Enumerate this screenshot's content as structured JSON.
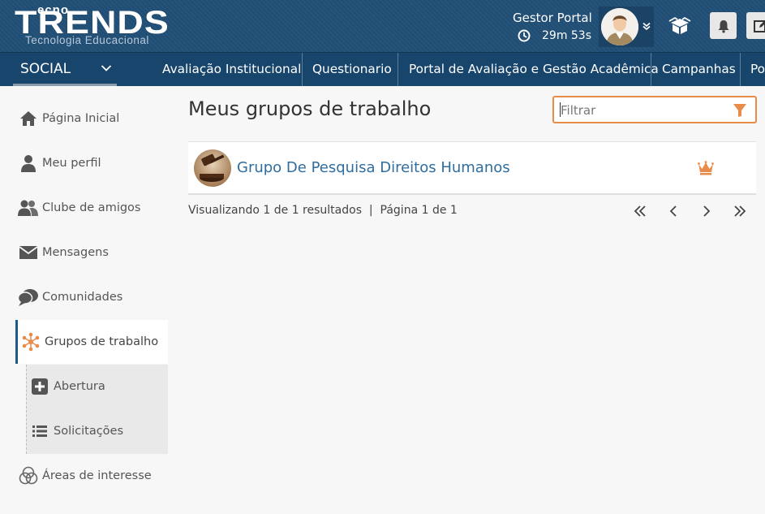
{
  "header": {
    "logo": {
      "top_text": "ecno",
      "main_text": "TRENDS",
      "sub_text": "Tecnologia Educacional"
    },
    "user_name": "Gestor Portal",
    "session_timer": "29m 53s",
    "icons": [
      "clock-icon",
      "avatar",
      "chevron-down-icon",
      "box-icon",
      "bell-icon",
      "edit-icon"
    ]
  },
  "nav": {
    "module": "SOCIAL",
    "items": [
      {
        "label": "Avaliação Institucional"
      },
      {
        "label": "Questionario"
      },
      {
        "label": "Portal de Avaliação e Gestão Acadêmica"
      },
      {
        "label": "Campanhas"
      },
      {
        "label": "Po"
      }
    ]
  },
  "sidebar": {
    "items": [
      {
        "label": "Página Inicial",
        "icon": "home-icon"
      },
      {
        "label": "Meu perfil",
        "icon": "user-icon"
      },
      {
        "label": "Clube de amigos",
        "icon": "users-icon"
      },
      {
        "label": "Mensagens",
        "icon": "envelope-icon"
      },
      {
        "label": "Comunidades",
        "icon": "chat-icon"
      },
      {
        "label": "Grupos de trabalho",
        "icon": "network-icon",
        "active": true
      },
      {
        "label": "Áreas de interesse",
        "icon": "circles-icon"
      }
    ],
    "subitems": [
      {
        "label": "Abertura",
        "icon": "plus-square-icon"
      },
      {
        "label": "Solicitações",
        "icon": "list-icon"
      }
    ]
  },
  "main": {
    "title": "Meus grupos de trabalho",
    "filter_placeholder": "Filtrar",
    "groups": [
      {
        "name": "Grupo De Pesquisa Direitos Humanos",
        "badge": "crown-icon"
      }
    ],
    "results_text": "Visualizando 1 de 1 resultados",
    "separator": "|",
    "page_text": "Página 1 de 1",
    "pager": [
      "first-page-icon",
      "prev-page-icon",
      "next-page-icon",
      "last-page-icon"
    ]
  },
  "colors": {
    "header_bg": "#1f4d74",
    "nav_bg": "#17456b",
    "accent_orange": "#e98c49",
    "link_blue": "#2f6d9f",
    "active_border": "#1d5a8c"
  }
}
